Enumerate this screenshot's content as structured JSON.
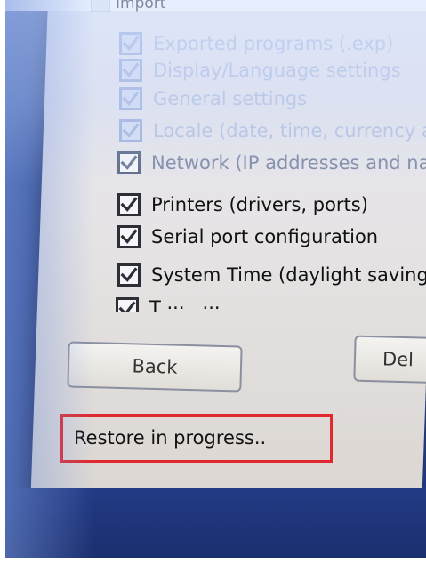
{
  "top_item": {
    "label": "Import"
  },
  "options": [
    {
      "id": "exported-programs",
      "label": "Exported programs (.exp)",
      "checked": true,
      "style": "faded"
    },
    {
      "id": "display-lang",
      "label": "Display/Language settings",
      "checked": true,
      "style": "faded"
    },
    {
      "id": "general",
      "label": "General settings",
      "checked": true,
      "style": "faded"
    },
    {
      "id": "locale",
      "label": "Locale (date, time, currency and",
      "checked": true,
      "style": "faded"
    },
    {
      "id": "network",
      "label": "Network (IP addresses and names)",
      "checked": true,
      "style": "mid"
    },
    {
      "id": "printers",
      "label": "Printers (drivers, ports)",
      "checked": true,
      "style": "normal"
    },
    {
      "id": "serial",
      "label": "Serial port configuration",
      "checked": true,
      "style": "normal"
    },
    {
      "id": "system-time",
      "label": "System Time (daylight saving)",
      "checked": true,
      "style": "normal"
    },
    {
      "id": "truncated",
      "label": "T        ···      ,      ···",
      "checked": true,
      "style": "normal"
    }
  ],
  "buttons": {
    "back": "Back",
    "next": "Del"
  },
  "status": {
    "text": "Restore in progress.."
  },
  "colors": {
    "highlight_border": "#e0282e",
    "background": "#2a4590"
  }
}
